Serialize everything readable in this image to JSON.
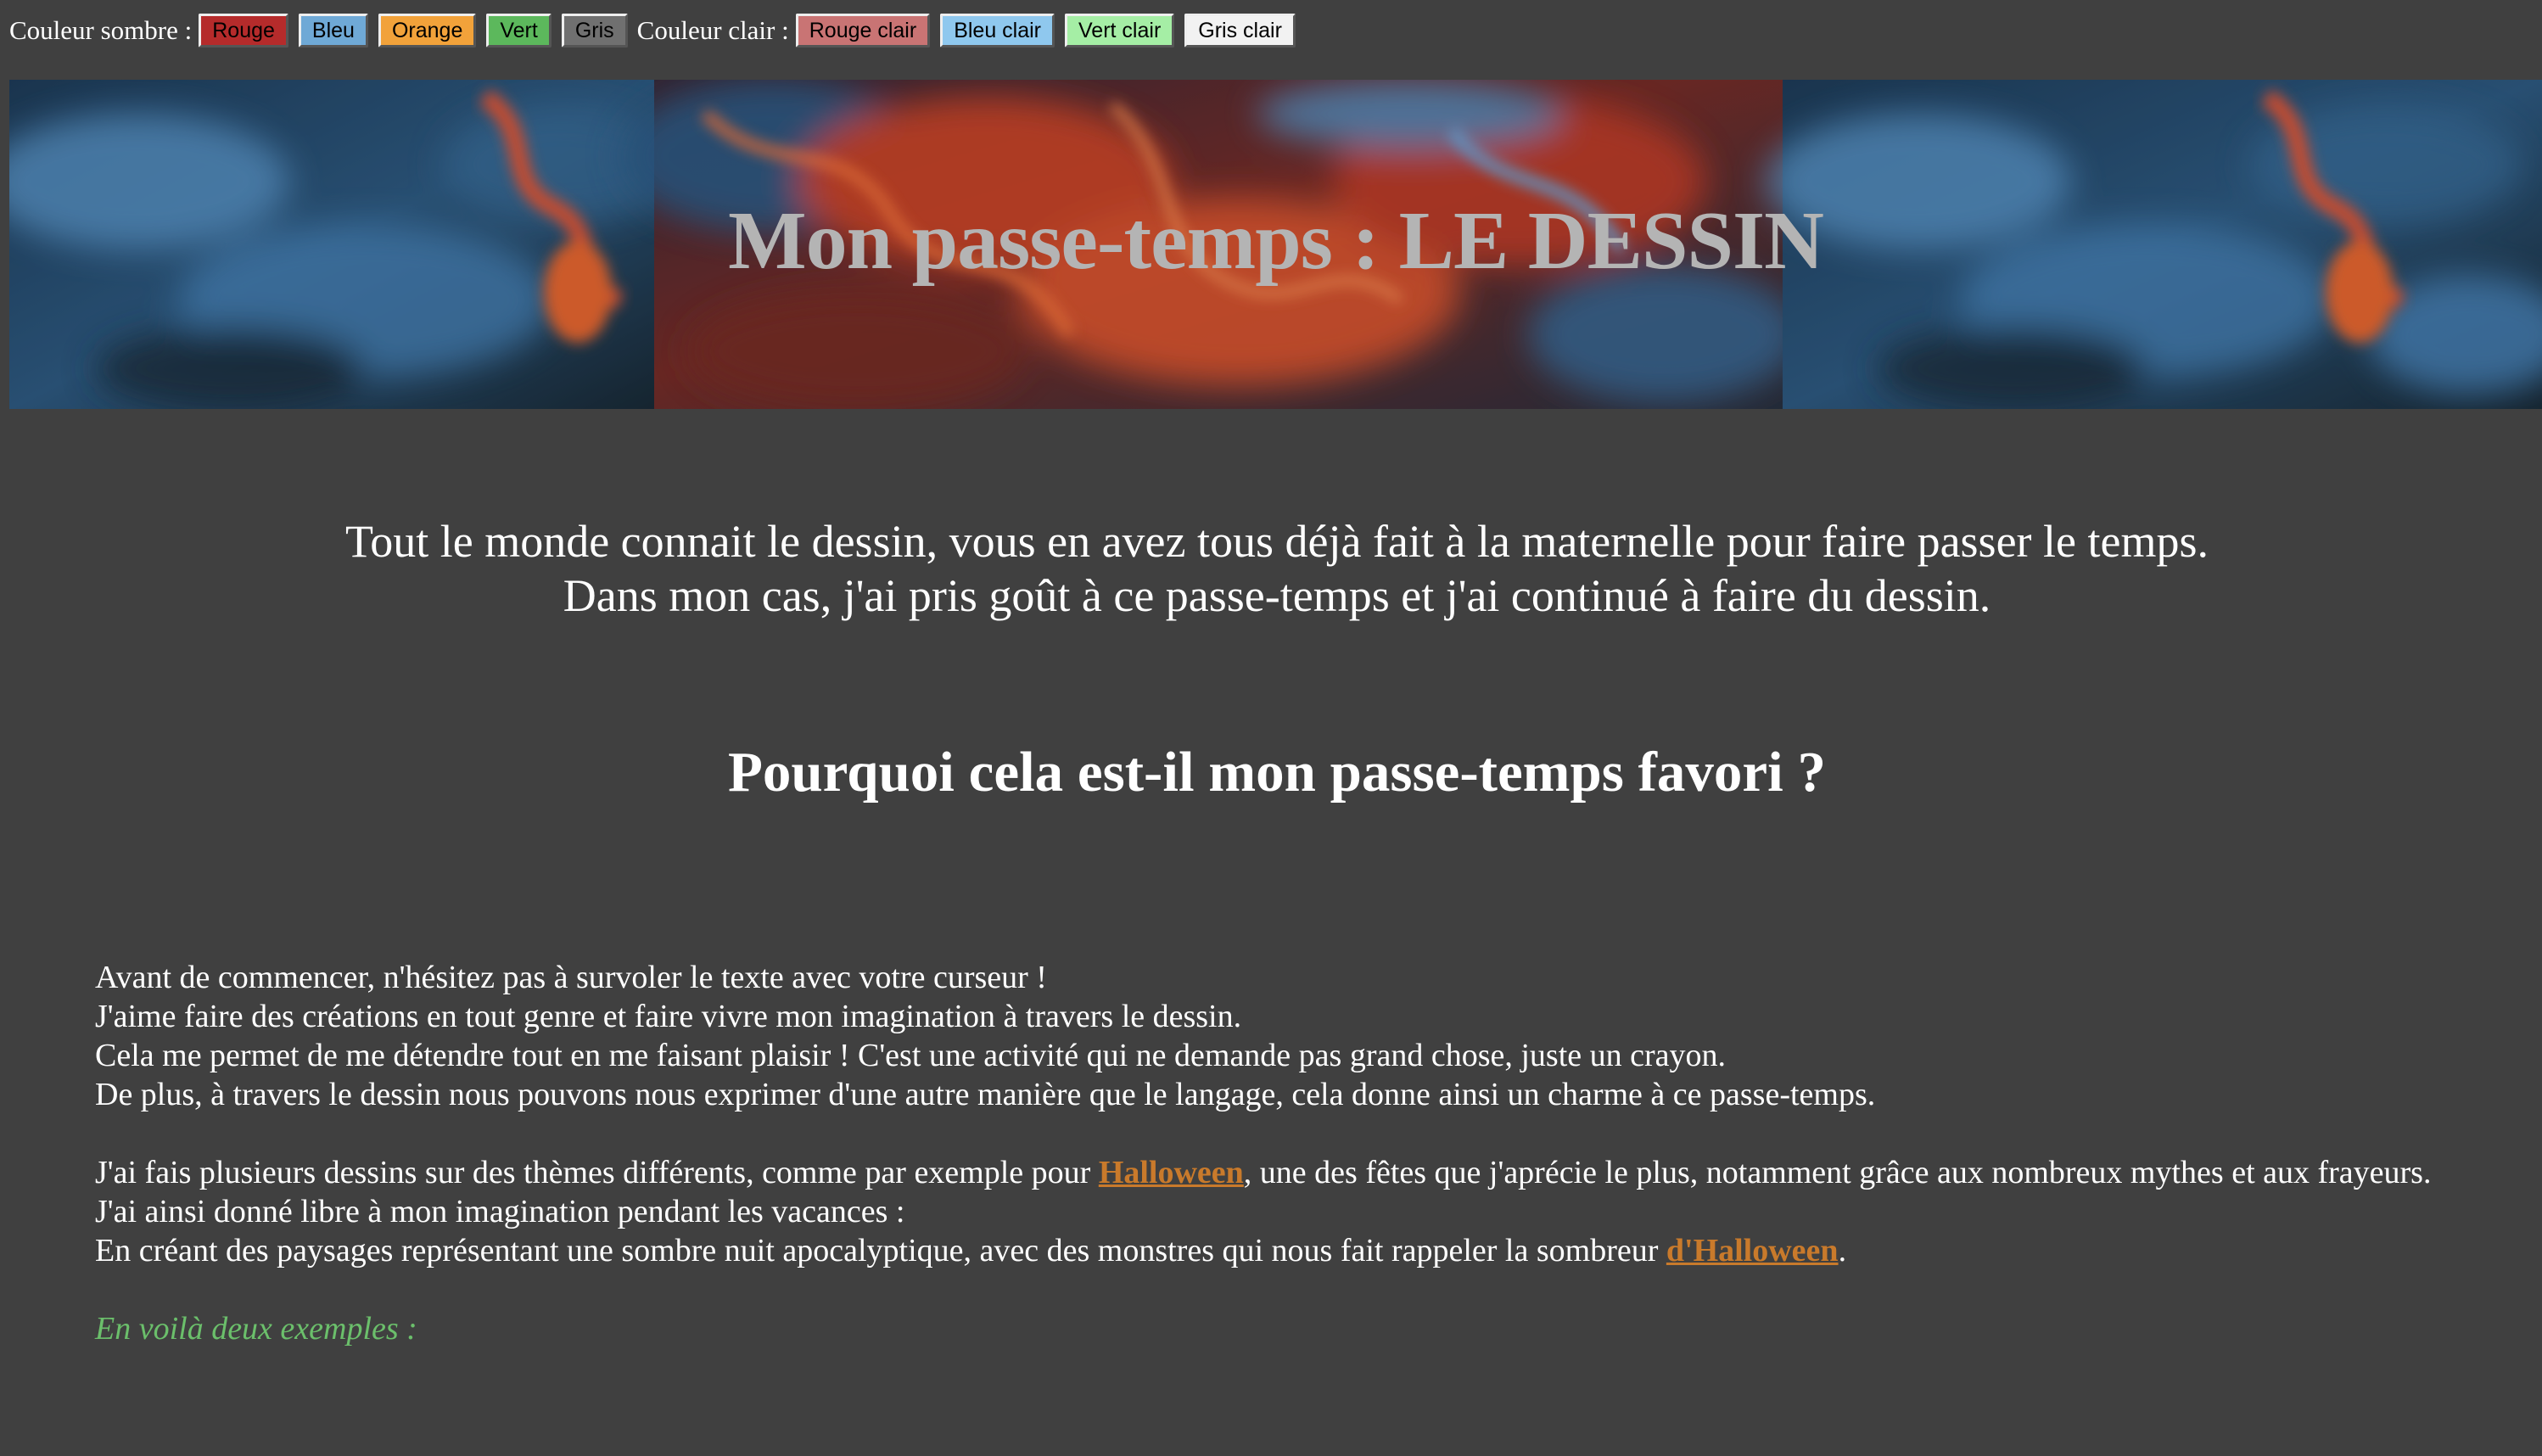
{
  "theme_bar": {
    "dark_label": "Couleur sombre :",
    "dark_buttons": [
      {
        "label": "Rouge",
        "color": "#b52b2b"
      },
      {
        "label": "Bleu",
        "color": "#6fa9d6"
      },
      {
        "label": "Orange",
        "color": "#f2a23a"
      },
      {
        "label": "Vert",
        "color": "#5cb85c"
      },
      {
        "label": "Gris",
        "color": "#707070"
      }
    ],
    "light_label": "Couleur clair :",
    "light_buttons": [
      {
        "label": "Rouge clair",
        "color": "#c97474"
      },
      {
        "label": "Bleu clair",
        "color": "#8fc8ee"
      },
      {
        "label": "Vert clair",
        "color": "#a5eea5"
      },
      {
        "label": "Gris clair",
        "color": "#f2f2f2"
      }
    ]
  },
  "banner": {
    "title": "Mon passe-temps : LE DESSIN"
  },
  "intro": {
    "line1": "Tout le monde connait le dessin, vous en avez tous déjà fait à la maternelle pour faire passer le temps.",
    "line2": "Dans mon cas, j'ai pris goût à ce passe-temps et j'ai continué à faire du dessin."
  },
  "section": {
    "title": "Pourquoi cela est-il mon passe-temps favori ?"
  },
  "body": {
    "p1": "Avant de commencer, n'hésitez pas à survoler le texte avec votre curseur !",
    "p2": "J'aime faire des créations en tout genre et faire vivre mon imagination à travers le dessin.",
    "p3": "Cela me permet de me détendre tout en me faisant plaisir ! C'est une activité qui ne demande pas grand chose, juste un crayon.",
    "p4": "De plus, à travers le dessin nous pouvons nous exprimer d'une autre manière que le langage, cela donne ainsi un charme à ce passe-temps.",
    "p5_before": "J'ai fais plusieurs dessins sur des thèmes différents, comme par exemple pour ",
    "p5_link": "Halloween",
    "p5_after": ", une des fêtes que j'aprécie le plus, notamment grâce aux nombreux mythes et aux frayeurs.",
    "p6": "J'ai ainsi donné libre à mon imagination pendant les vacances :",
    "p7_before": "En créant des paysages représentant une sombre nuit apocalyptique, avec des monstres qui nous fait rappeler la sombreur ",
    "p7_link": "d'Halloween",
    "p7_after": ".",
    "examples": "En voilà deux exemples :"
  },
  "colors": {
    "background": "#404040",
    "link": "#c97a2b",
    "examples": "#6bbf6b",
    "banner_title": "#b4b4b4"
  }
}
